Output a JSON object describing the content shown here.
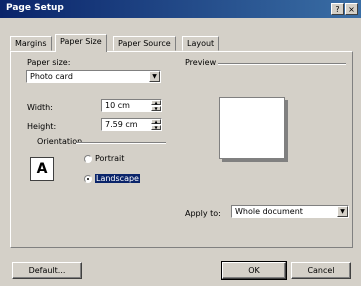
{
  "window": {
    "title": "Page Setup",
    "help_label": "?",
    "close_label": "×"
  },
  "tabs": [
    {
      "label": "Margins"
    },
    {
      "label": "Paper Size"
    },
    {
      "label": "Paper Source"
    },
    {
      "label": "Layout"
    }
  ],
  "paper_size": {
    "label": "Paper size:",
    "value": "Photo card",
    "width_label": "Width:",
    "width_value": "10 cm",
    "height_label": "Height:",
    "height_value": "7.59 cm"
  },
  "orientation": {
    "label": "Orientation",
    "icon_glyph": "A",
    "portrait_label": "Portrait",
    "landscape_label": "Landscape",
    "selected": "landscape"
  },
  "preview": {
    "label": "Preview"
  },
  "apply_to": {
    "label": "Apply to:",
    "value": "Whole document"
  },
  "buttons": {
    "default": "Default...",
    "ok": "OK",
    "cancel": "Cancel"
  }
}
